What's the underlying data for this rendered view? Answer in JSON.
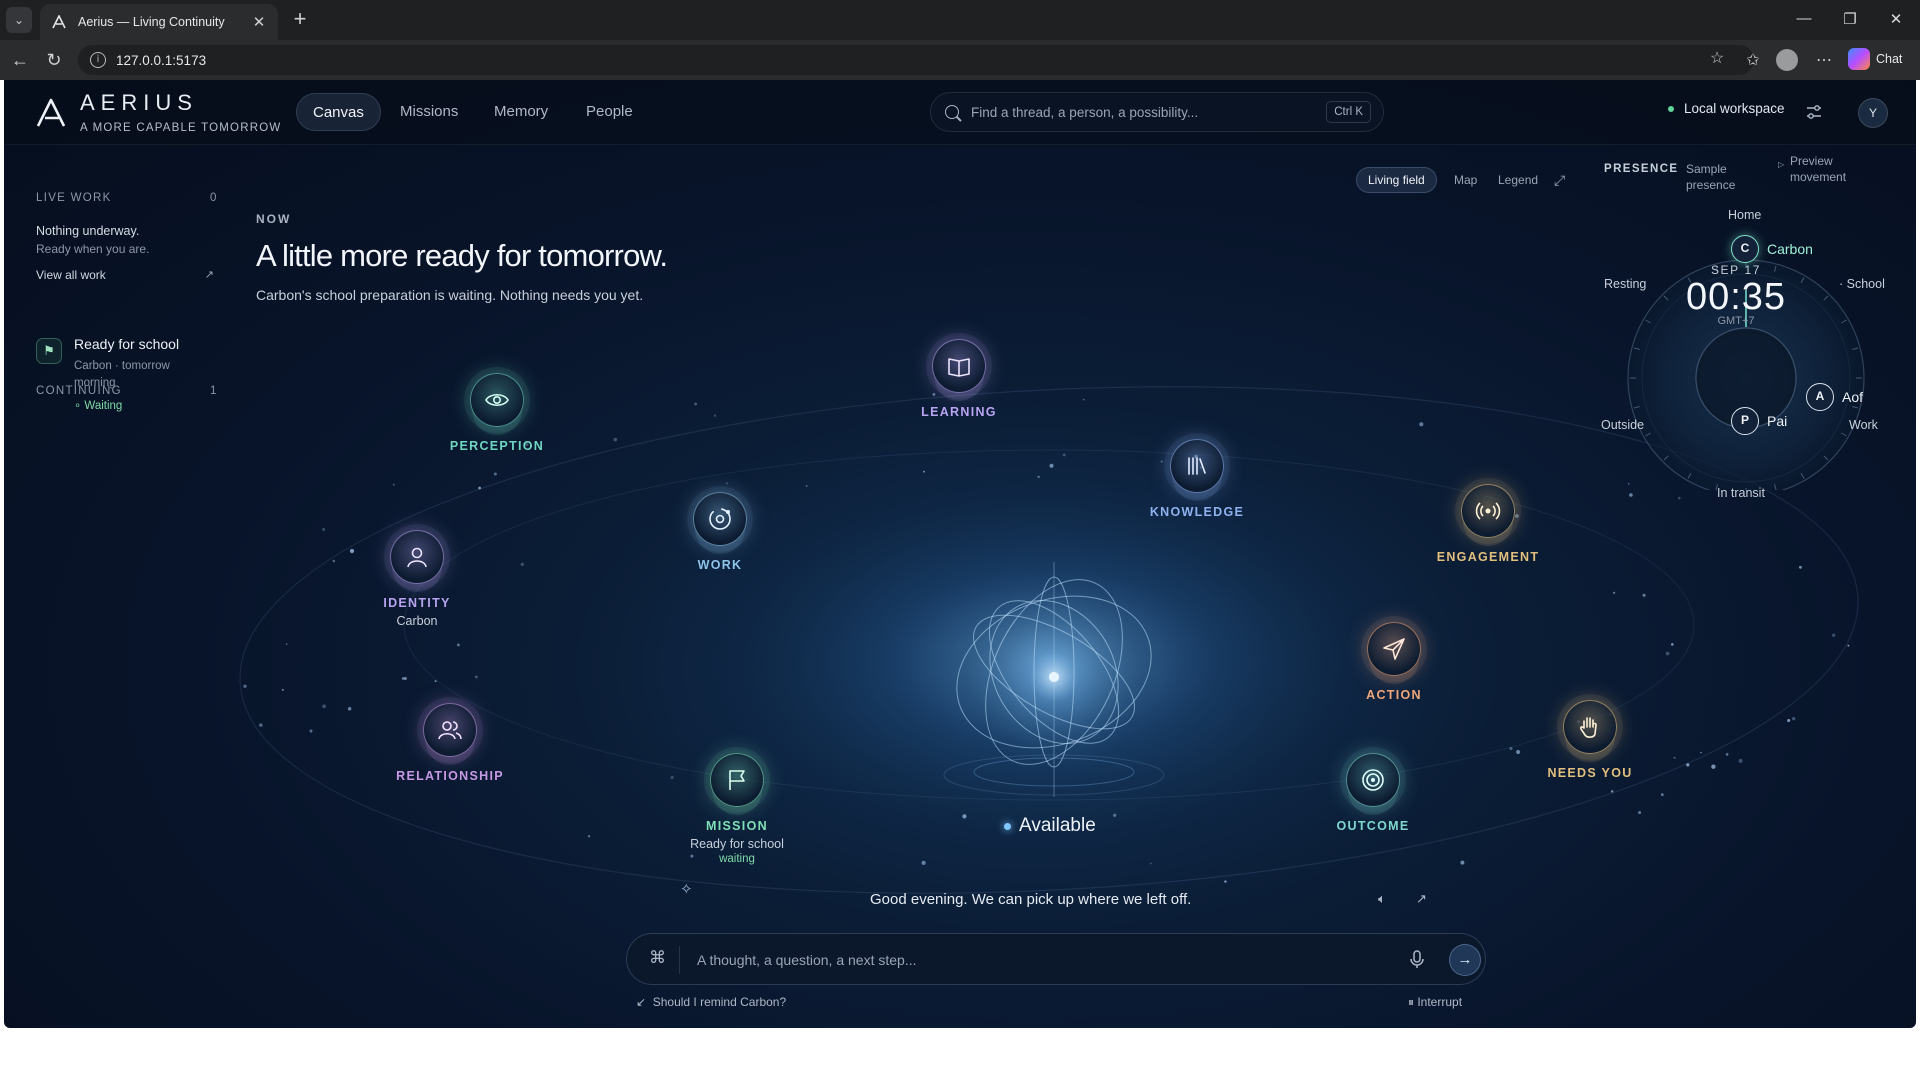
{
  "browser": {
    "tab_title": "Aerius — Living Continuity",
    "url": "127.0.0.1:5173",
    "chat_label": "Chat"
  },
  "header": {
    "brand": "AERIUS",
    "tagline": "A MORE CAPABLE TOMORROW",
    "nav": [
      {
        "label": "Canvas",
        "active": true
      },
      {
        "label": "Missions",
        "active": false
      },
      {
        "label": "Memory",
        "active": false
      },
      {
        "label": "People",
        "active": false
      }
    ],
    "search_placeholder": "Find a thread, a person, a possibility...",
    "search_shortcut": "Ctrl K",
    "workspace": "Local workspace",
    "user_initial": "Y"
  },
  "sidebar": {
    "live_work": {
      "title": "LIVE WORK",
      "count": "0",
      "empty_title": "Nothing underway.",
      "empty_sub": "Ready when you are.",
      "link": "View all work"
    },
    "continuing": {
      "title": "CONTINUING",
      "count": "1",
      "item_title": "Ready for school",
      "item_sub": "Carbon · tomorrow morning",
      "item_status": "Waiting"
    }
  },
  "hero": {
    "label": "NOW",
    "title": "A little more ready for tomorrow.",
    "subtitle": "Carbon's school preparation is waiting. Nothing needs you yet."
  },
  "view_switch": {
    "options": [
      "Living field",
      "Map",
      "Legend"
    ],
    "active": "Living field"
  },
  "presence": {
    "label": "PRESENCE",
    "mode": "Sample presence",
    "preview": "Preview movement",
    "date": "SEP 17",
    "time": "00:35",
    "timezone": "GMT+7",
    "places": {
      "top": "Home",
      "upper_left": "Resting",
      "upper_right": "School",
      "lower_left": "Outside",
      "lower_right": "Work",
      "bottom": "In transit"
    },
    "people": [
      {
        "initial": "C",
        "name": "Carbon",
        "highlight": true
      },
      {
        "initial": "A",
        "name": "Aof",
        "highlight": false
      },
      {
        "initial": "P",
        "name": "Pai",
        "highlight": false
      }
    ]
  },
  "nodes": {
    "perception": {
      "label": "PERCEPTION",
      "icon": "eye-icon",
      "color": "#6fd6c2"
    },
    "learning": {
      "label": "LEARNING",
      "icon": "book-icon",
      "color": "#b9a4f2"
    },
    "knowledge": {
      "label": "KNOWLEDGE",
      "icon": "library-icon",
      "color": "#8fb1f0"
    },
    "work": {
      "label": "WORK",
      "icon": "orbit-icon",
      "color": "#8fc3ea"
    },
    "identity": {
      "label": "IDENTITY",
      "sub": "Carbon",
      "icon": "person-icon",
      "color": "#b7a3ef"
    },
    "engagement": {
      "label": "ENGAGEMENT",
      "icon": "broadcast-icon",
      "color": "#e2bf7d"
    },
    "action": {
      "label": "ACTION",
      "icon": "send-icon",
      "color": "#f0a77a"
    },
    "relationship": {
      "label": "RELATIONSHIP",
      "icon": "people-icon",
      "color": "#c799e4"
    },
    "mission": {
      "label": "MISSION",
      "sub": "Ready for school",
      "status": "waiting",
      "icon": "flag-icon",
      "color": "#7fe0b6"
    },
    "outcome": {
      "label": "OUTCOME",
      "icon": "target-icon",
      "color": "#7fd8d0"
    },
    "needs_you": {
      "label": "NEEDS YOU",
      "icon": "hand-icon",
      "color": "#e2bf7d"
    }
  },
  "core": {
    "status": "Available"
  },
  "assistant": {
    "greeting": "Good evening. We can pick up where we left off.",
    "composer_placeholder": "A thought, a question, a next step...",
    "suggestion": "Should I remind Carbon?",
    "interrupt": "Interrupt"
  }
}
